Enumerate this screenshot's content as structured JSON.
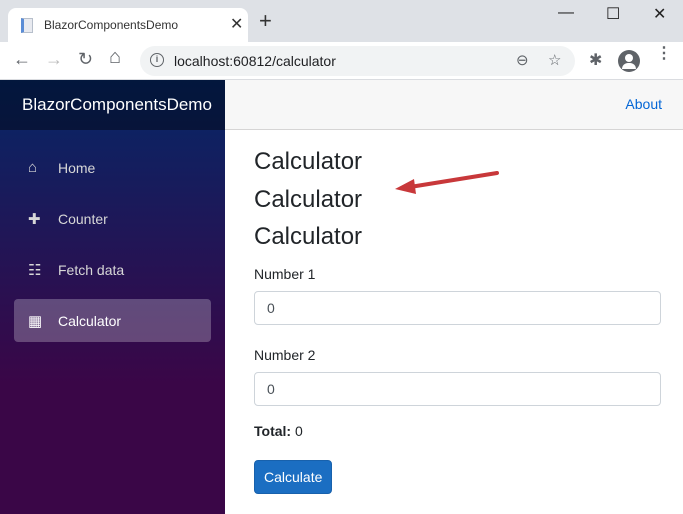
{
  "browser": {
    "tab_title": "BlazorComponentsDemo",
    "tab_close": "✕",
    "new_tab": "+",
    "url": "localhost:60812/calculator",
    "minimize": "—",
    "maximize": "☐",
    "close": "✕",
    "back": "←",
    "forward": "→",
    "reload": "↻",
    "home": "⌂",
    "info": "i",
    "zoom_icon": "⊖",
    "star_icon": "☆",
    "extensions_icon": "✱",
    "menu_icon": "⋮"
  },
  "sidebar": {
    "brand": "BlazorComponentsDemo",
    "items": [
      {
        "label": "Home",
        "icon": "⌂",
        "active": false
      },
      {
        "label": "Counter",
        "icon": "✚",
        "active": false
      },
      {
        "label": "Fetch data",
        "icon": "☷",
        "active": false
      },
      {
        "label": "Calculator",
        "icon": "▦",
        "active": true
      }
    ]
  },
  "topbar": {
    "about": "About"
  },
  "main": {
    "headings": [
      "Calculator",
      "Calculator",
      "Calculator"
    ],
    "number1_label": "Number 1",
    "number1_value": "0",
    "number2_label": "Number 2",
    "number2_value": "0",
    "total_label": "Total:",
    "total_value": "0",
    "calculate_button": "Calculate"
  },
  "colors": {
    "accent": "#1b6ec2",
    "link": "#0366d6",
    "annotation_arrow": "#c8383a"
  }
}
